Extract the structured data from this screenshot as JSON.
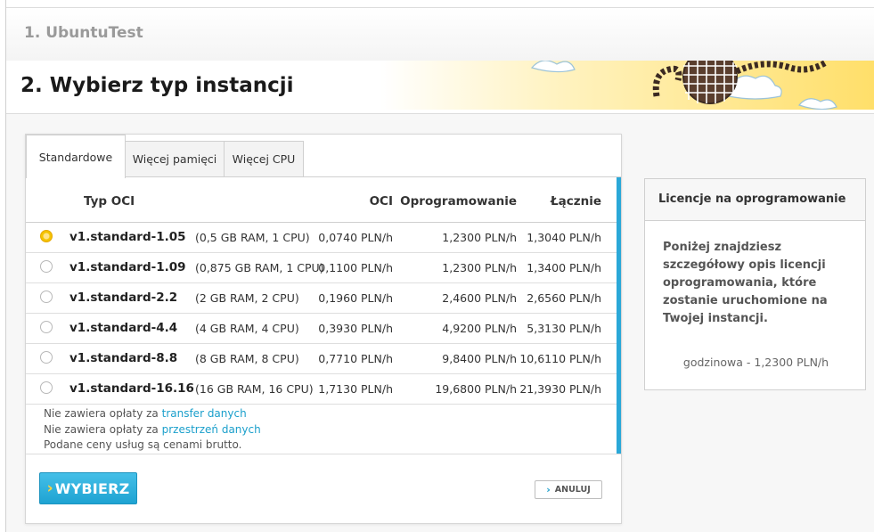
{
  "step1": {
    "title": "1. UbuntuTest"
  },
  "step2": {
    "title": "2. Wybierz typ instancji"
  },
  "tabs": [
    {
      "label": "Standardowe",
      "active": true
    },
    {
      "label": "Więcej pamięci",
      "active": false
    },
    {
      "label": "Więcej CPU",
      "active": false
    }
  ],
  "table": {
    "headers": {
      "type": "Typ OCI",
      "oci": "OCI",
      "software": "Oprogramowanie",
      "total": "Łącznie"
    },
    "rows": [
      {
        "name": "v1.standard-1.05",
        "spec": "(0,5 GB RAM, 1 CPU)",
        "oci": "0,0740 PLN/h",
        "software": "1,2300 PLN/h",
        "total": "1,3040 PLN/h",
        "selected": true
      },
      {
        "name": "v1.standard-1.09",
        "spec": "(0,875 GB RAM, 1 CPU)",
        "oci": "0,1100 PLN/h",
        "software": "1,2300 PLN/h",
        "total": "1,3400 PLN/h",
        "selected": false
      },
      {
        "name": "v1.standard-2.2",
        "spec": "(2 GB RAM, 2 CPU)",
        "oci": "0,1960 PLN/h",
        "software": "2,4600 PLN/h",
        "total": "2,6560 PLN/h",
        "selected": false
      },
      {
        "name": "v1.standard-4.4",
        "spec": "(4 GB RAM, 4 CPU)",
        "oci": "0,3930 PLN/h",
        "software": "4,9200 PLN/h",
        "total": "5,3130 PLN/h",
        "selected": false
      },
      {
        "name": "v1.standard-8.8",
        "spec": "(8 GB RAM, 8 CPU)",
        "oci": "0,7710 PLN/h",
        "software": "9,8400 PLN/h",
        "total": "10,6110 PLN/h",
        "selected": false
      },
      {
        "name": "v1.standard-16.16",
        "spec": "(16 GB RAM, 16 CPU)",
        "oci": "1,7130 PLN/h",
        "software": "19,6800 PLN/h",
        "total": "21,3930 PLN/h",
        "selected": false
      }
    ]
  },
  "notes": {
    "line1_prefix": "Nie zawiera opłaty za ",
    "line1_link": "transfer danych",
    "line2_prefix": "Nie zawiera opłaty za ",
    "line2_link": "przestrzeń danych",
    "line3": "Podane ceny usług są cenami brutto."
  },
  "buttons": {
    "select": "WYBIERZ",
    "cancel": "ANULUJ"
  },
  "license": {
    "title": "Licencje na oprogramowanie",
    "description": "Poniżej znajdziesz szczegółowy opis licencji oprogramowania, które zostanie uruchomione na Twojej instancji.",
    "price": "godzinowa - 1,2300 PLN/h"
  },
  "colors": {
    "accent": "#1ea3d2",
    "selected_radio": "#f4c300",
    "banner_yellow": "#ffe070"
  }
}
